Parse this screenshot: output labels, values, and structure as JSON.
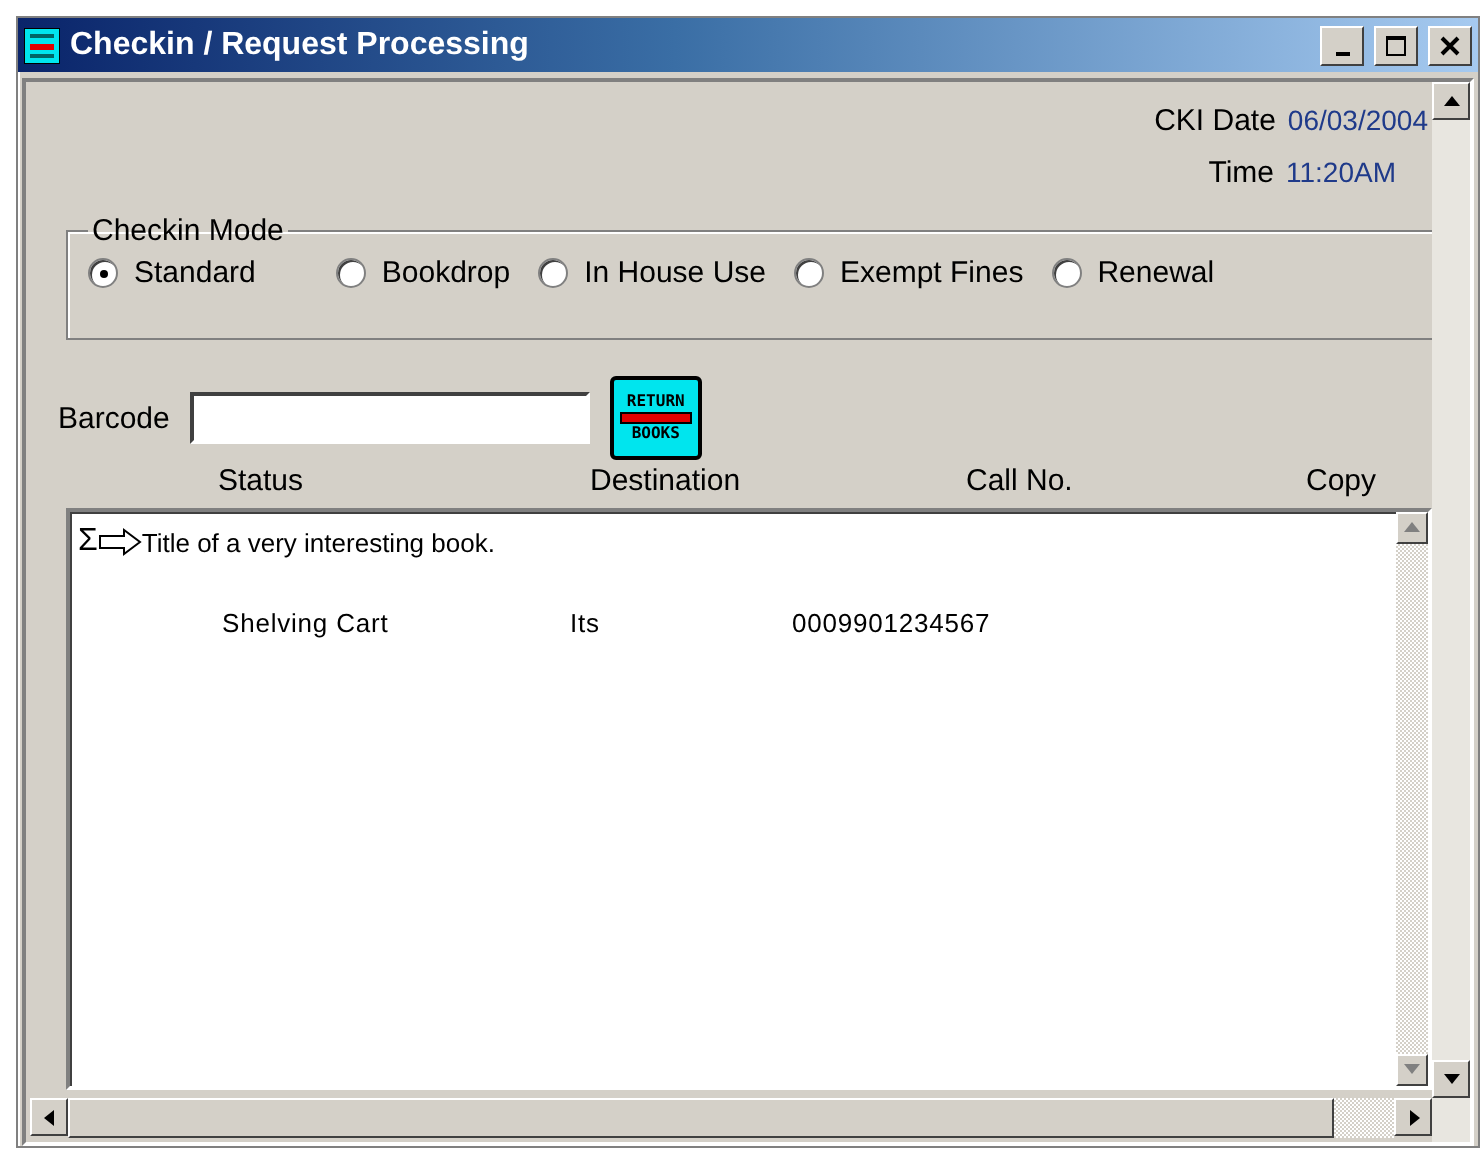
{
  "window": {
    "title": "Checkin / Request Processing"
  },
  "header": {
    "date_label": "CKI Date",
    "date": "06/03/2004",
    "time_label": "Time",
    "time": "11:20AM"
  },
  "checkin_mode": {
    "label": "Checkin Mode",
    "options": [
      {
        "label": "Standard",
        "selected": true
      },
      {
        "label": "Bookdrop",
        "selected": false
      },
      {
        "label": "In House Use",
        "selected": false
      },
      {
        "label": "Exempt Fines",
        "selected": false
      },
      {
        "label": "Renewal",
        "selected": false
      }
    ]
  },
  "barcode": {
    "label": "Barcode"
  },
  "return_button": {
    "lines": [
      "RETURN",
      "BOOKS"
    ]
  },
  "table": {
    "columns": [
      "Status",
      "Destination",
      "Call No.",
      "Copy"
    ],
    "rows": [
      {
        "marker": "Σ",
        "title": "Title of a very interesting book.",
        "cells": [
          "Shelving Cart",
          "Its",
          "0009901234567"
        ]
      }
    ]
  }
}
